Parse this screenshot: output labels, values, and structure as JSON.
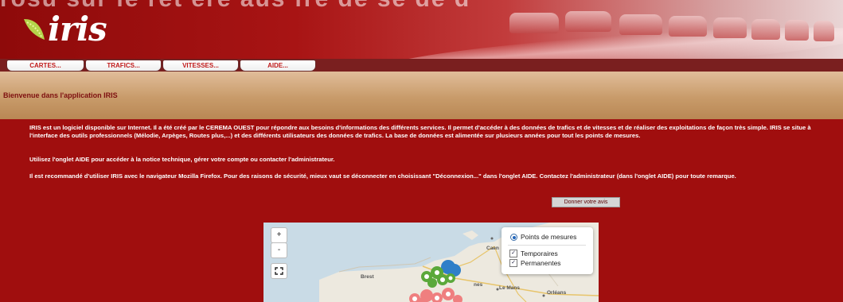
{
  "header": {
    "logo_text": "iris",
    "top_partial_text": "rosu sur le ret ere aus fre de se de d"
  },
  "menu": [
    {
      "label": "CARTES..."
    },
    {
      "label": "TRAFICS..."
    },
    {
      "label": "VITESSES..."
    },
    {
      "label": "AIDE..."
    }
  ],
  "welcome": {
    "title": "Bienvenue dans l'application IRIS"
  },
  "content": {
    "p1": "IRIS est un logiciel disponible sur Internet. Il a été créé par le CEREMA OUEST pour répondre aux besoins d'informations des différents services. Il permet d'accéder à des données de trafics et de vitesses et de réaliser des exploitations de façon très simple. IRIS se situe à l'interface des outils professionnels (Mélodie, Arpèges, Routes plus,...) et des différents utilisateurs des données de trafics. La base de données est alimentée sur plusieurs années pour tout les points de mesures.",
    "p2": "Utilisez l'onglet AIDE pour accéder à la notice technique, gérer votre compte ou contacter l'administrateur.",
    "p3": "Il est recommandé d'utiliser IRIS avec le navigateur Mozilla Firefox. Pour des raisons de sécurité, mieux vaut se déconnecter en choisissant \"Déconnexion...\" dans l'onglet AIDE. Contactez l'administrateur (dans l'onglet AIDE) pour toute remarque.",
    "avis_button": "Donner votre avis"
  },
  "map": {
    "zoom_in": "+",
    "zoom_out": "-",
    "layers": {
      "radio_label": "Points de mesures",
      "checkbox_1": "Temporaires",
      "checkbox_1_checked": true,
      "checkbox_2": "Permanentes",
      "checkbox_2_checked": true,
      "check_mark": "✓"
    },
    "cities": {
      "brest": "Brest",
      "caen": "Caen",
      "le_mans": "Le Mans",
      "orleans": "Orléans",
      "rennes_partial": "nes"
    },
    "colors": {
      "sea": "#c9dbe6",
      "land": "#ede9df",
      "marker_green": "#5aa83a",
      "marker_blue": "#2f7fc8",
      "marker_pink": "#ef7f7f"
    }
  }
}
